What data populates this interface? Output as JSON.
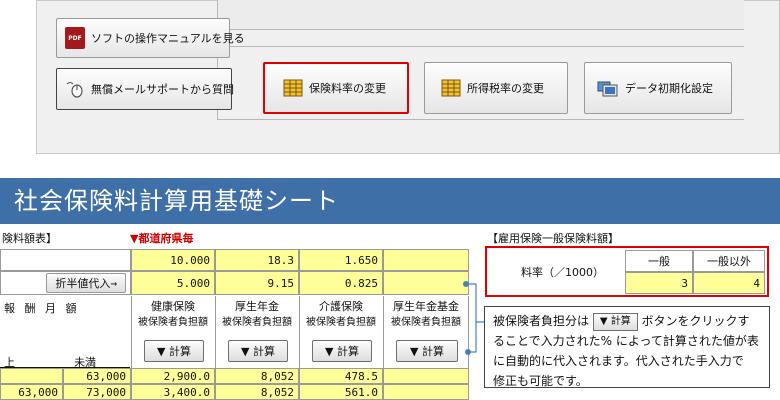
{
  "toolbar": {
    "manual_label": "ソフトの操作マニュアルを見る",
    "support_label": "無償メールサポートから質問",
    "hoken_label": "保険料率の変更",
    "shotoku_label": "所得税率の変更",
    "data_init_label": "データ初期化設定",
    "pdf_icon_text": "PDF"
  },
  "sheet": {
    "title": "社会保険料計算用基礎シート",
    "left_header": "険料額表】",
    "prefecture_label": "▼都道府県毎",
    "rates_row1": [
      "10.000",
      "18.3",
      "1.650"
    ],
    "half_label": "折半値代入→",
    "rates_row2": [
      "5.000",
      "9.15",
      "0.825"
    ],
    "monthly_label": "報 酬 月 額",
    "columns": [
      {
        "title": "健康保険",
        "sub": "被保険者負担額"
      },
      {
        "title": "厚生年金",
        "sub": "被保険者負担額"
      },
      {
        "title": "介護保険",
        "sub": "被保険者負担額"
      },
      {
        "title": "厚生年金基金",
        "sub": "被保険者負担額"
      }
    ],
    "calc_label": "▼ 計算",
    "range_from_label": "上",
    "range_to_label": "未満",
    "rows": [
      {
        "from": "",
        "to": "63,000",
        "health": "2,900.0",
        "pension": "8,052",
        "care": "478.5"
      },
      {
        "from": "63,000",
        "to": "73,000",
        "health": "3,400.0",
        "pension": "8,052",
        "care": "561.0"
      }
    ]
  },
  "employment": {
    "header": "【雇用保険一般保険料額】",
    "rate_label": "料率（／1000）",
    "col_general": "一般",
    "col_other": "一般以外",
    "val_general": "3",
    "val_other": "4"
  },
  "info": {
    "line1_pre": "被保険者負担分は",
    "button": "▼ 計算",
    "line1_post": "ボタンをクリックす",
    "line2": "ることで入力された% によって計算された値が表",
    "line3": "に自動的に代入されます。代入された手入力で",
    "line4": "修正も可能です。"
  },
  "colors": {
    "title_bar": "#3f6fa7",
    "highlight_red": "#e00000",
    "cell_yellow": "#ffff99"
  }
}
